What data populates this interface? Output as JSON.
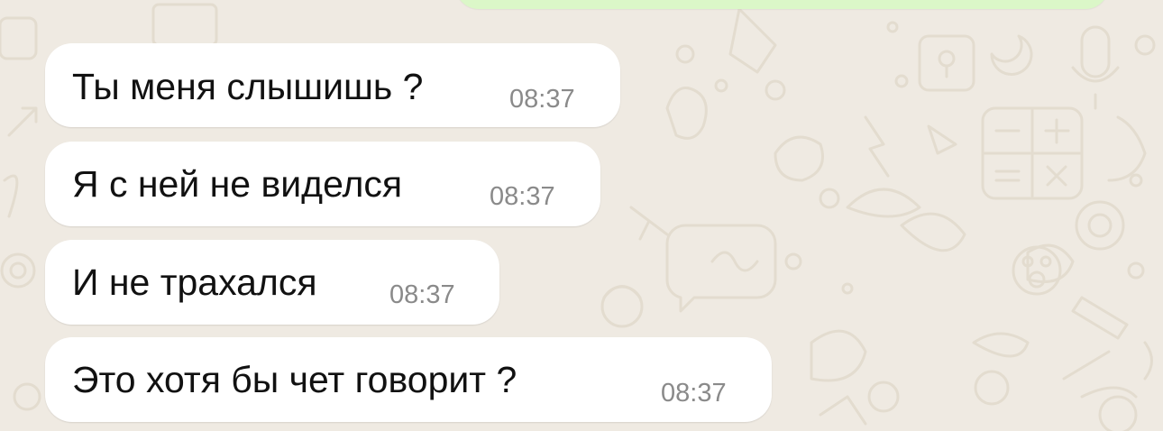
{
  "theme": {
    "wallpaper_color": "#efeae2",
    "doodle_color": "#e3dccf",
    "incoming_bubble_color": "#ffffff",
    "outgoing_bubble_color": "#dbf7c8",
    "message_text_color": "#111111",
    "timestamp_color": "#8a8a8a"
  },
  "messages": [
    {
      "text": "Ты меня слышишь ?",
      "time": "08:37",
      "direction": "incoming"
    },
    {
      "text": "Я с ней не виделся",
      "time": "08:37",
      "direction": "incoming"
    },
    {
      "text": "И не трахался",
      "time": "08:37",
      "direction": "incoming"
    },
    {
      "text": "Это хотя бы чет говорит ?",
      "time": "08:37",
      "direction": "incoming"
    }
  ]
}
